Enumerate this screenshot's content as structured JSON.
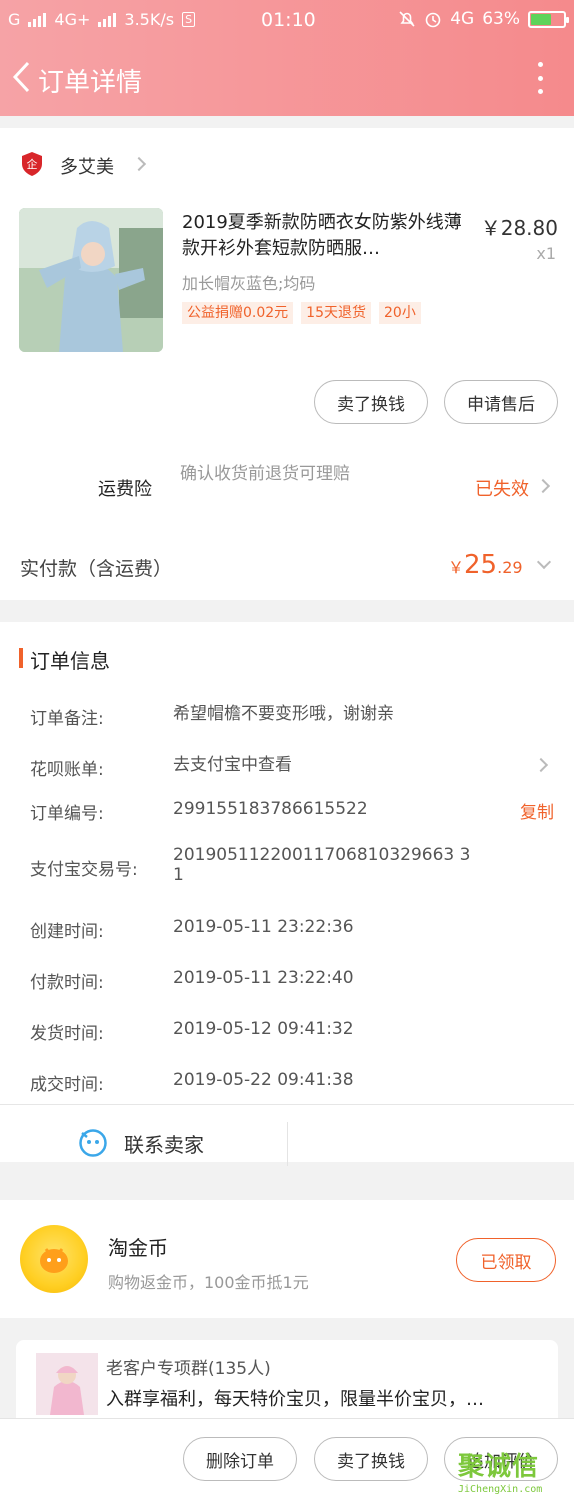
{
  "status_bar": {
    "carrier_left": "G",
    "network1": "4G+",
    "speed": "3.5K/s",
    "speed_badge": "S",
    "time": "01:10",
    "network2": "4G",
    "battery": "63%"
  },
  "nav": {
    "title": "订单详情"
  },
  "shop": {
    "name": "多艾美",
    "logo_char": "企"
  },
  "product": {
    "title": "2019夏季新款防晒衣女防紫外线薄款开衫外套短款防晒服…",
    "price": "￥28.80",
    "quantity": "x1",
    "sku": "加长帽灰蓝色;均码",
    "tags": [
      "公益捐赠0.02元",
      "15天退货",
      "20小"
    ]
  },
  "actions": {
    "sell_label": "卖了换钱",
    "after_sale_label": "申请售后"
  },
  "insurance": {
    "label": "运费险",
    "desc": "确认收货前退货可理赔",
    "status": "已失效"
  },
  "payment": {
    "label": "实付款（含运费）",
    "currency": "￥",
    "amount_int": "25",
    "amount_dec": ".29"
  },
  "order_info": {
    "title": "订单信息",
    "rows": [
      {
        "label": "订单备注:",
        "value": "希望帽檐不要变形哦，谢谢亲"
      },
      {
        "label": "花呗账单:",
        "value": "去支付宝中查看"
      },
      {
        "label": "订单编号:",
        "value": "299155183786615522"
      },
      {
        "label": "支付宝交易号:",
        "value": "20190511220011706810329663 3 1"
      },
      {
        "label": "创建时间:",
        "value": "2019-05-11 23:22:36"
      },
      {
        "label": "付款时间:",
        "value": "2019-05-11 23:22:40"
      },
      {
        "label": "发货时间:",
        "value": "2019-05-12 09:41:32"
      },
      {
        "label": "成交时间:",
        "value": "2019-05-22 09:41:38"
      }
    ],
    "copy_label": "复制"
  },
  "contact": {
    "label": "联系卖家"
  },
  "coin": {
    "title": "淘金币",
    "subtitle": "购物返金币，100金币抵1元",
    "button": "已领取"
  },
  "group": {
    "title": "老客户专项群(135人)",
    "desc": "入群享福利，每天特价宝贝，限量半价宝贝，…"
  },
  "bottom_bar": {
    "delete_label": "删除订单",
    "sell_label": "卖了换钱",
    "review_label": "追加评价"
  },
  "watermark": {
    "text": "聚诚信",
    "url": "JiChengXin.com"
  },
  "colors": {
    "accent": "#f0622b",
    "header_start": "#f6a3a6",
    "header_end": "#f58a8c"
  }
}
